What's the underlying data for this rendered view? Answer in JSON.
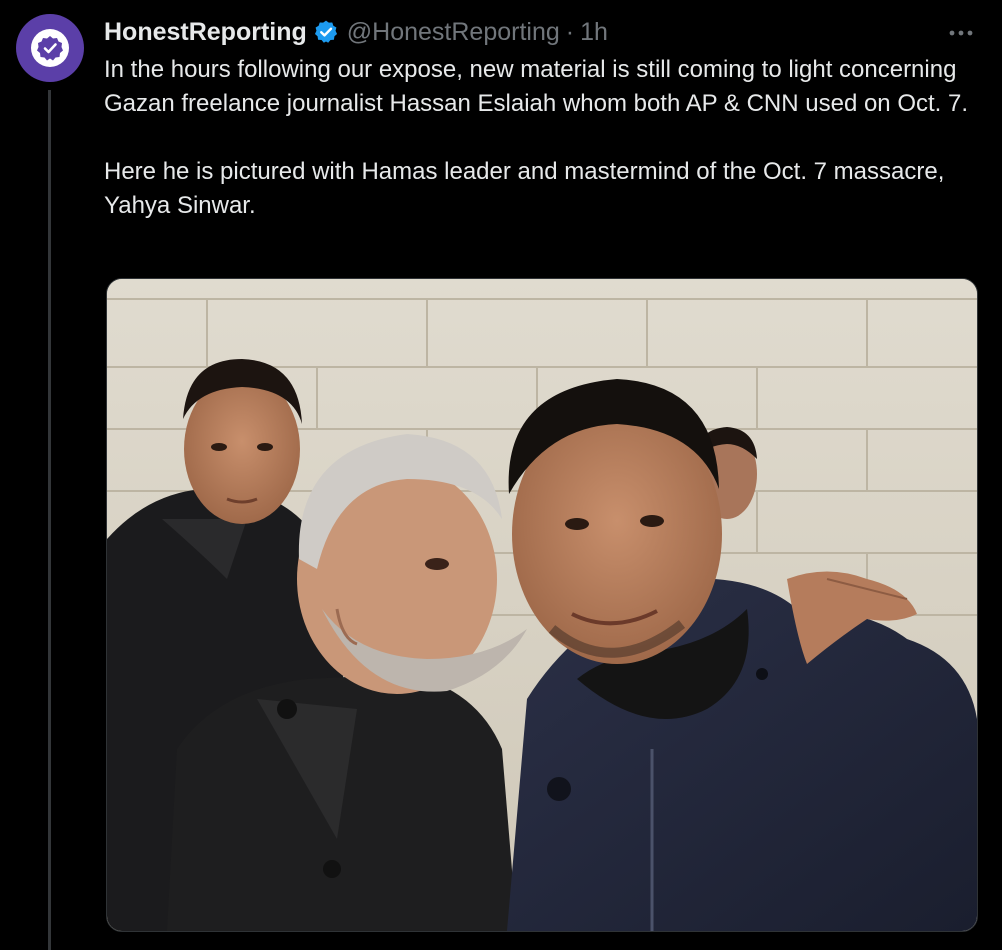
{
  "tweet": {
    "author": {
      "display_name": "HonestReporting",
      "handle": "@HonestReporting",
      "verified": true,
      "avatar_icon": "check-badge-icon",
      "avatar_color": "#5b3fa8"
    },
    "separator": "·",
    "time": "1h",
    "more_icon": "more-dots-icon",
    "text": {
      "paragraph_1": "In the hours following our expose, new material is still coming to light concerning Gazan freelance journalist Hassan Eslaiah whom both AP & CNN used on Oct. 7.",
      "paragraph_2": "Here he is pictured with Hamas leader and mastermind of the Oct. 7 massacre, Yahya Sinwar."
    },
    "media": {
      "type": "photo"
    }
  },
  "colors": {
    "background": "#000000",
    "text_primary": "#e7e9ea",
    "text_secondary": "#71767b",
    "verified_blue": "#1d9bf0",
    "thread_line": "#333639"
  }
}
